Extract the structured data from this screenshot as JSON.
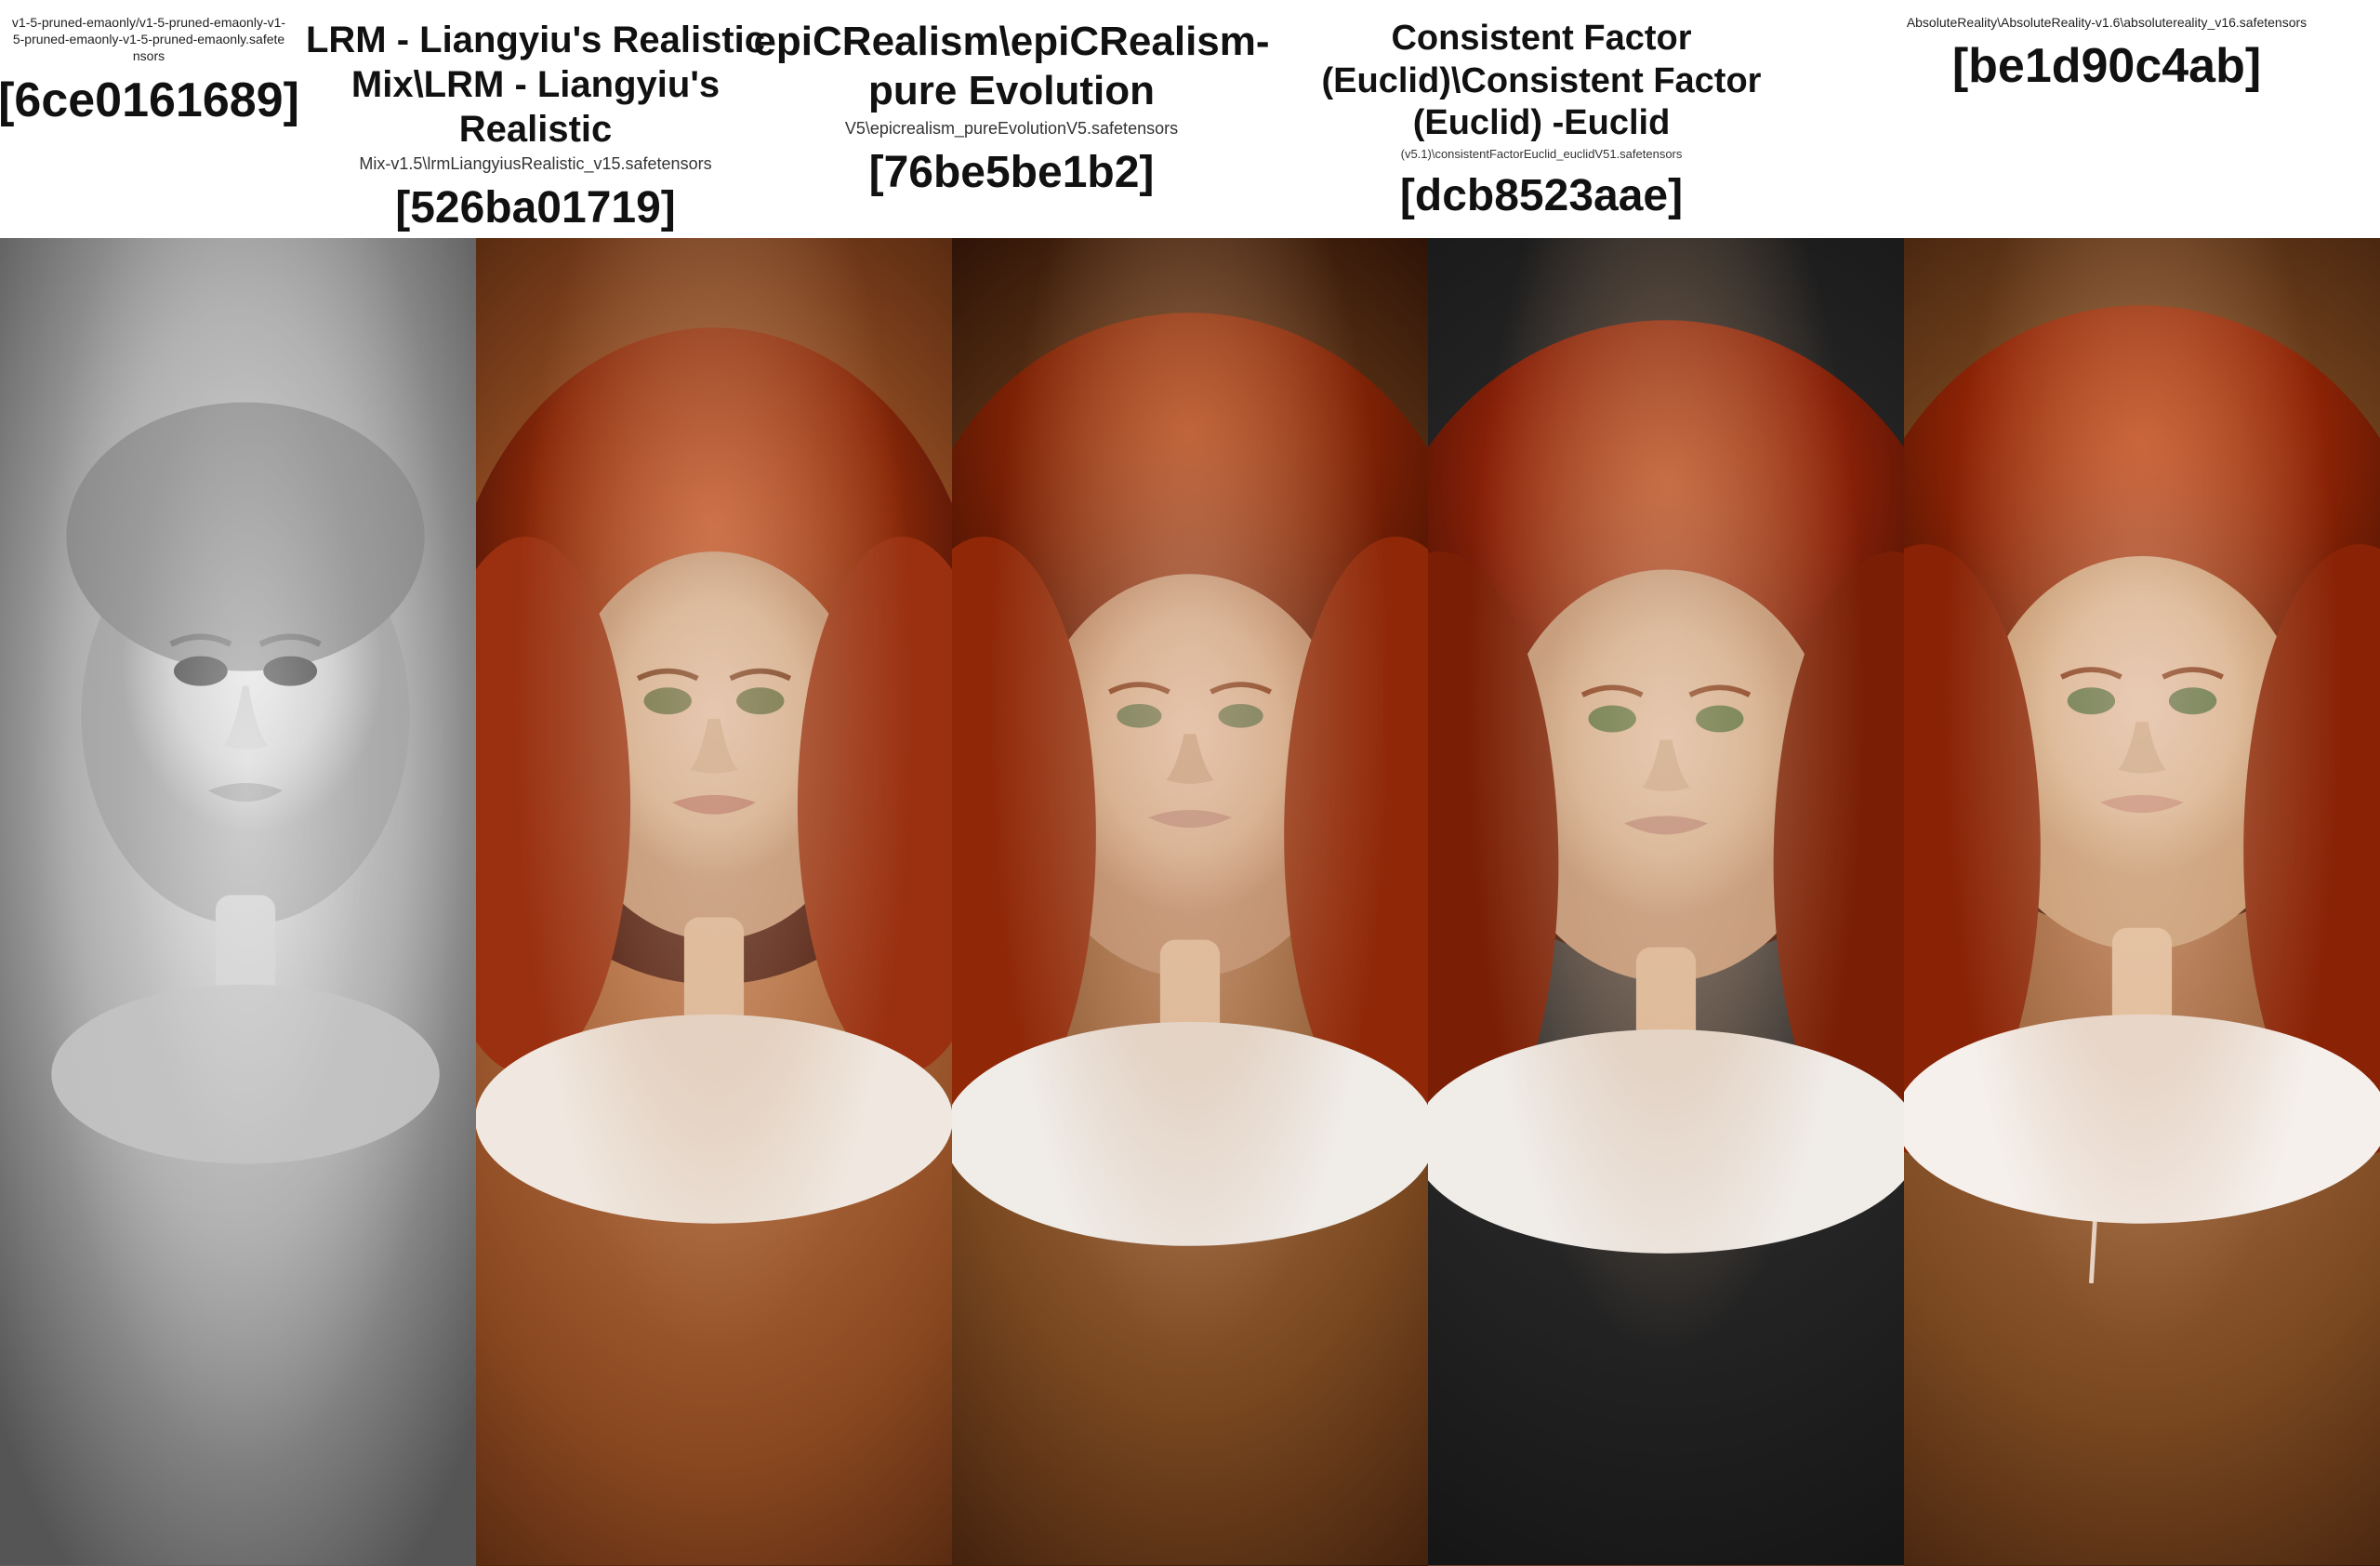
{
  "columns": [
    {
      "id": "col1",
      "path": "v1-5-pruned-emaonly/v1-5-pruned-emaonly-v1-5-pruned-emaonly-v1-5-pruned-emaonly.safetensors",
      "name": null,
      "file": null,
      "hash": "[6ce0161689]",
      "imgClass": "img-col-1",
      "overlayClass": "face-overlay-bw"
    },
    {
      "id": "col2",
      "path": null,
      "name": "LRM - Liangyiu's Realistic Mix\\LRM - Liangyiu's Realistic",
      "file": "Mix-v1.5\\lrmLiangyiusRealistic_v15.safetensors",
      "hash": "[526ba01719]",
      "imgClass": "img-col-2",
      "overlayClass": "face-overlay"
    },
    {
      "id": "col3",
      "path": "epiCRealism\\epiCRealism-pure Evolution",
      "name": null,
      "file": "V5\\epicrealism_pureEvolutionV5.safetensors",
      "hash": "[76be5be1b2]",
      "imgClass": "img-col-3",
      "overlayClass": "face-overlay"
    },
    {
      "id": "col4",
      "path": null,
      "name": "Consistent Factor (Euclid)\\Consistent Factor (Euclid) -Euclid",
      "file": "(v5.1)\\consistentFactorEuclid_euclidV51.safetensors",
      "hash": "[dcb8523aae]",
      "imgClass": "img-col-4",
      "overlayClass": "face-overlay"
    },
    {
      "id": "col5",
      "path": "AbsoluteReality\\AbsoluteReality-v1.6\\absolutereality_v16.safetensors",
      "name": null,
      "file": null,
      "hash": "[be1d90c4ab]",
      "imgClass": "img-col-5",
      "overlayClass": "face-overlay"
    }
  ]
}
